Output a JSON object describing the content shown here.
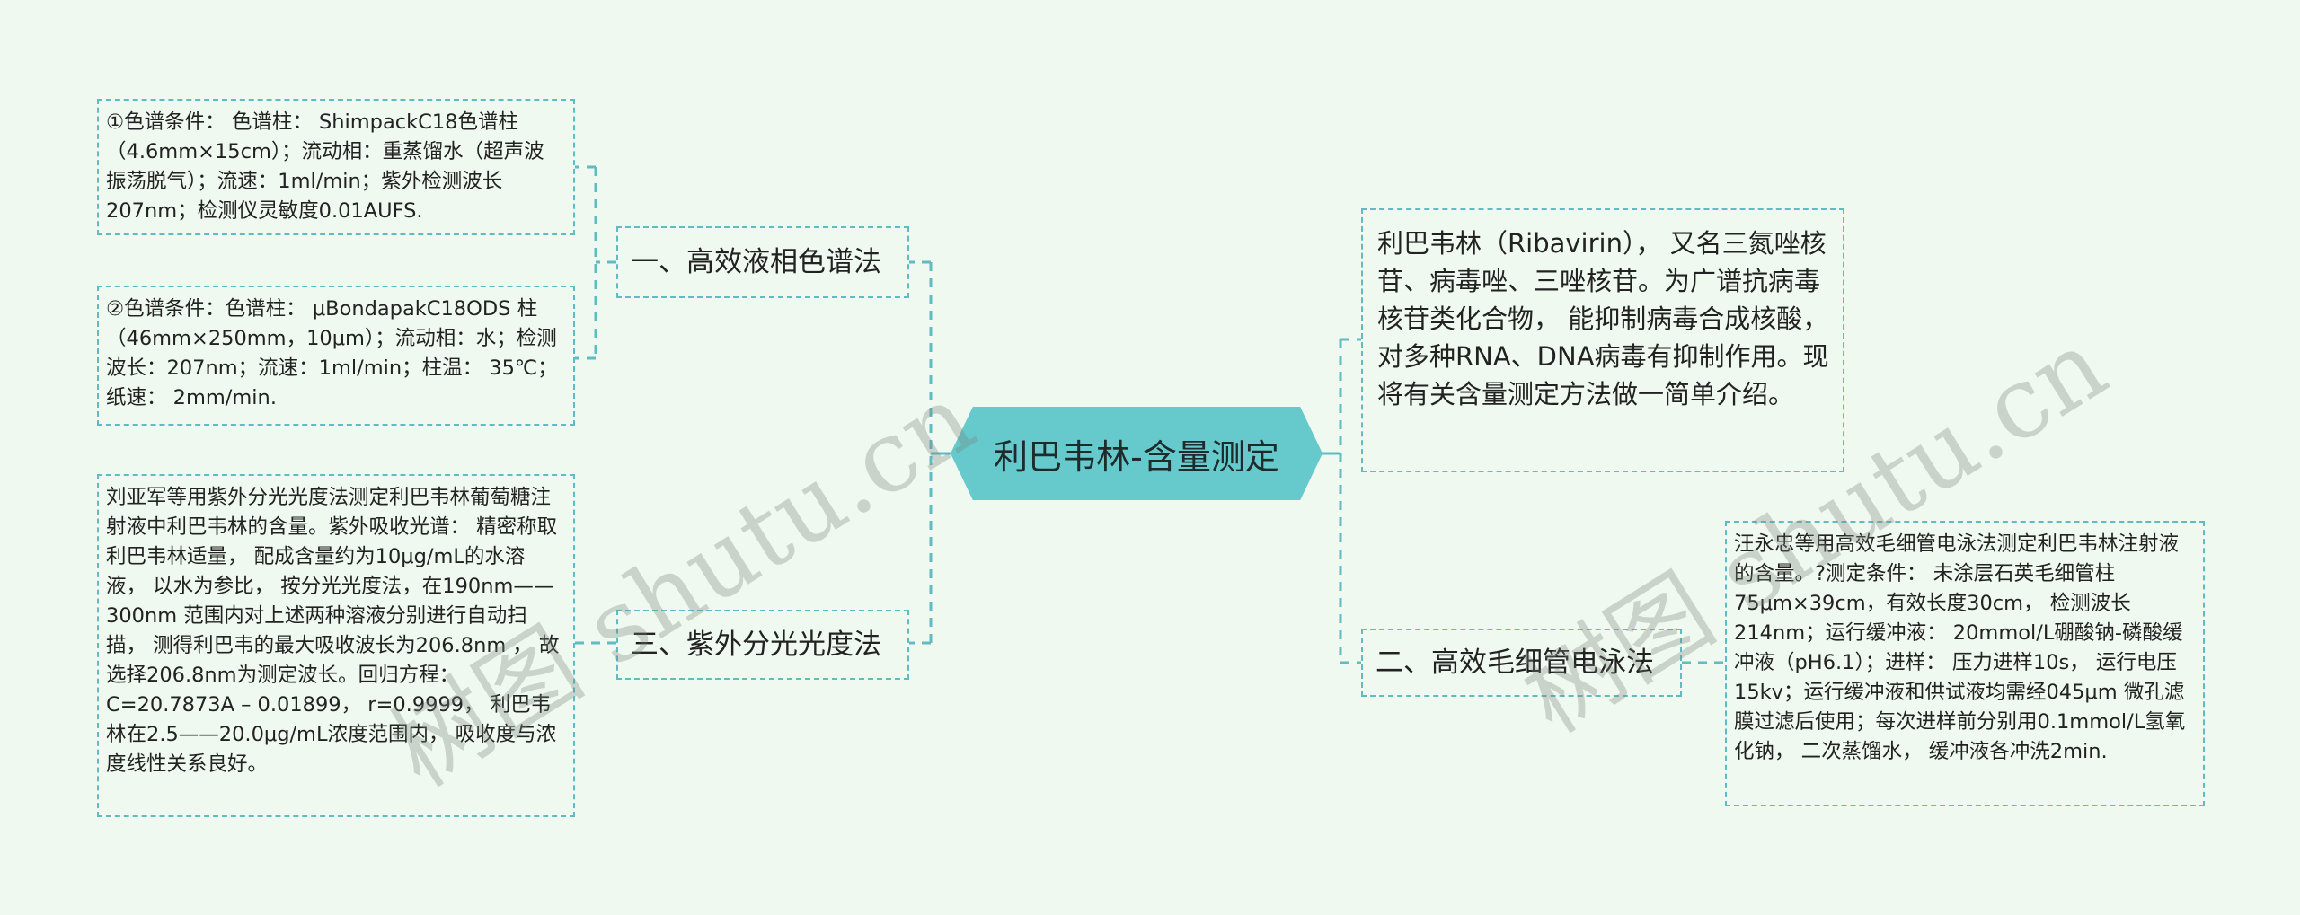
{
  "root": {
    "title": "利巴韦林-含量测定"
  },
  "intro": {
    "text": "利巴韦林（Ribavirin）， 又名三氮唑核苷、病毒唑、三唑核苷。为广谱抗病毒核苷类化合物， 能抑制病毒合成核酸， 对多种RNA、DNA病毒有抑制作用。现将有关含量测定方法做一简单介绍。"
  },
  "branches": [
    {
      "label": "一、高效液相色谱法",
      "children": [
        "①色谱条件： 色谱柱： ShimpackC18色谱柱（4.6mm×15cm）；流动相：重蒸馏水（超声波振荡脱气）；流速：1ml/min；紫外检测波长207nm；检测仪灵敏度0.01AUFS.",
        "②色谱条件：色谱柱： μBondapakC18ODS 柱（46mm×250mm，10μm）；流动相：水；检测波长：207nm；流速：1ml/min；柱温： 35℃；纸速： 2mm/min."
      ]
    },
    {
      "label": "二、高效毛细管电泳法",
      "children": [
        "汪永忠等用高效毛细管电泳法测定利巴韦林注射液的含量。?测定条件： 未涂层石英毛细管柱75μm×39cm，有效长度30cm， 检测波长214nm；运行缓冲液： 20mmol/L硼酸钠-磷酸缓冲液（pH6.1）；进样： 压力进样10s， 运行电压15kv；运行缓冲液和供试液均需经045μm 微孔滤膜过滤后使用；每次进样前分别用0.1mmol/L氢氧化钠， 二次蒸馏水， 缓冲液各冲洗2min."
      ]
    },
    {
      "label": "三、紫外分光光度法",
      "children": [
        "刘亚军等用紫外分光光度法测定利巴韦林葡萄糖注射液中利巴韦林的含量。紫外吸收光谱： 精密称取利巴韦林适量， 配成含量约为10μg/mL的水溶液， 以水为参比， 按分光光度法，在190nm——300nm 范围内对上述两种溶液分别进行自动扫描， 测得利巴韦的最大吸收波长为206.8nm ， 故选择206.8nm为测定波长。回归方程： C=20.7873A – 0.01899， r=0.9999， 利巴韦林在2.5——20.0μg/mL浓度范围内， 吸收度与浓度线性关系良好。"
      ]
    }
  ],
  "watermarks": [
    "树图 shutu.cn",
    "树图 shutu.cn"
  ],
  "colors": {
    "background": "#f0f9ef",
    "accent": "#5fbcc4",
    "root_fill": "#66c9cc"
  }
}
